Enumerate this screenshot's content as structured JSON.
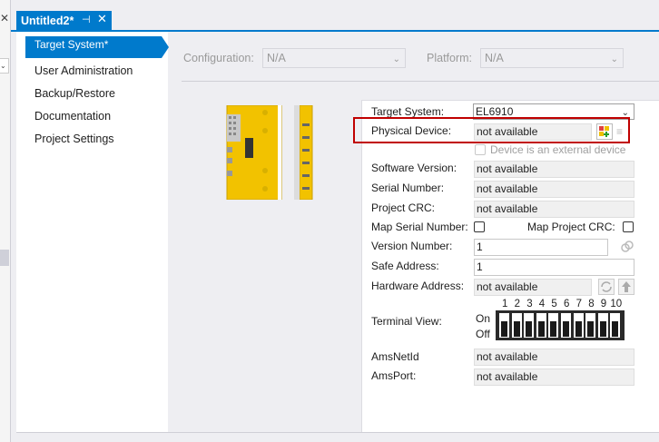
{
  "tab": {
    "title": "Untitled2*",
    "pin": "⊣",
    "close": "✕"
  },
  "left": {
    "close": "✕"
  },
  "nav": {
    "items": [
      {
        "label": "Target System*",
        "active": true
      },
      {
        "label": "User Administration"
      },
      {
        "label": "Backup/Restore"
      },
      {
        "label": "Documentation"
      },
      {
        "label": "Project Settings"
      }
    ]
  },
  "top_bar": {
    "configuration_label": "Configuration:",
    "configuration_value": "N/A",
    "platform_label": "Platform:",
    "platform_value": "N/A"
  },
  "form": {
    "target_system_label": "Target System:",
    "target_system_value": "EL6910",
    "physical_device_label": "Physical Device:",
    "physical_device_value": "not available",
    "external_device_label": "Device is an external device",
    "software_version_label": "Software Version:",
    "software_version_value": "not available",
    "serial_number_label": "Serial Number:",
    "serial_number_value": "not available",
    "project_crc_label": "Project CRC:",
    "project_crc_value": "not available",
    "map_serial_label": "Map Serial Number:",
    "map_project_crc_label": "Map Project CRC:",
    "version_number_label": "Version Number:",
    "version_number_value": "1",
    "safe_address_label": "Safe Address:",
    "safe_address_value": "1",
    "hardware_address_label": "Hardware Address:",
    "hardware_address_value": "not available",
    "terminal_view_label": "Terminal View:",
    "on_label": "On",
    "off_label": "Off",
    "switch_numbers": [
      "1",
      "2",
      "3",
      "4",
      "5",
      "6",
      "7",
      "8",
      "9",
      "10"
    ],
    "amsnetid_label": "AmsNetId",
    "amsnetid_value": "not available",
    "amsport_label": "AmsPort:",
    "amsport_value": "not available"
  },
  "colors": {
    "accent": "#007acc",
    "highlight": "#c00000",
    "device": "#f5c400"
  }
}
